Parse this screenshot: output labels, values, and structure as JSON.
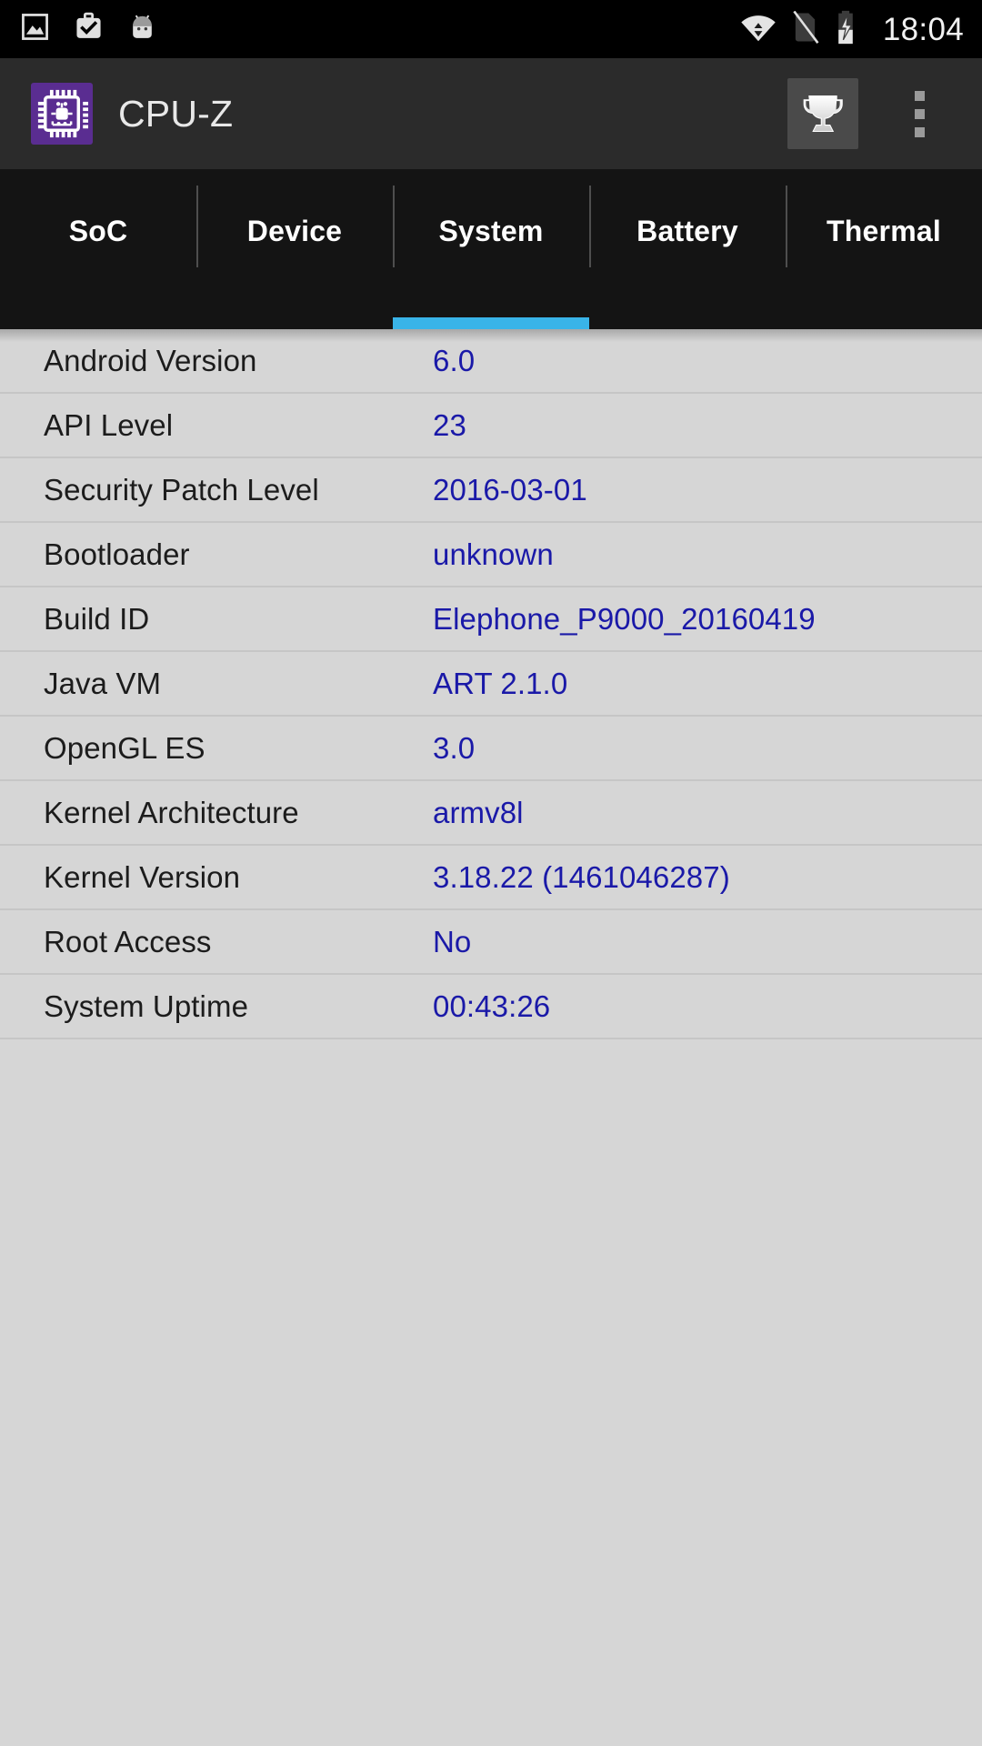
{
  "status_bar": {
    "icons_left": [
      "screenshot-image-icon",
      "work-briefcase-check-icon",
      "android-head-icon"
    ],
    "icons_right": [
      "wifi-data-activity-icon",
      "no-sim-card-icon",
      "battery-charging-icon"
    ],
    "clock": "18:04"
  },
  "app_bar": {
    "logo_icon": "cpu-chip-icon",
    "title": "CPU-Z",
    "trophy_icon": "trophy-icon",
    "overflow_icon": "overflow-menu-icon"
  },
  "tabs": {
    "active_index": 2,
    "items": [
      {
        "label": "SoC"
      },
      {
        "label": "Device"
      },
      {
        "label": "System"
      },
      {
        "label": "Battery"
      },
      {
        "label": "Thermal"
      }
    ]
  },
  "system_info": {
    "rows": [
      {
        "label": "Android Version",
        "value": "6.0"
      },
      {
        "label": "API Level",
        "value": "23"
      },
      {
        "label": "Security Patch Level",
        "value": "2016-03-01"
      },
      {
        "label": "Bootloader",
        "value": "unknown"
      },
      {
        "label": "Build ID",
        "value": "Elephone_P9000_20160419"
      },
      {
        "label": "Java VM",
        "value": "ART 2.1.0"
      },
      {
        "label": "OpenGL ES",
        "value": "3.0"
      },
      {
        "label": "Kernel Architecture",
        "value": "armv8l"
      },
      {
        "label": "Kernel Version",
        "value": "3.18.22 (1461046287)"
      },
      {
        "label": "Root Access",
        "value": "No"
      },
      {
        "label": "System Uptime",
        "value": "00:43:26"
      }
    ]
  },
  "colors": {
    "status_bar_bg": "#000000",
    "app_bar_bg": "#2b2b2b",
    "tab_bar_bg": "#141414",
    "tab_indicator": "#39b4e8",
    "content_bg": "#d6d6d6",
    "value_text": "#1a19a8",
    "label_text": "#1c1c1c",
    "logo_bg": "#5a2d91"
  }
}
